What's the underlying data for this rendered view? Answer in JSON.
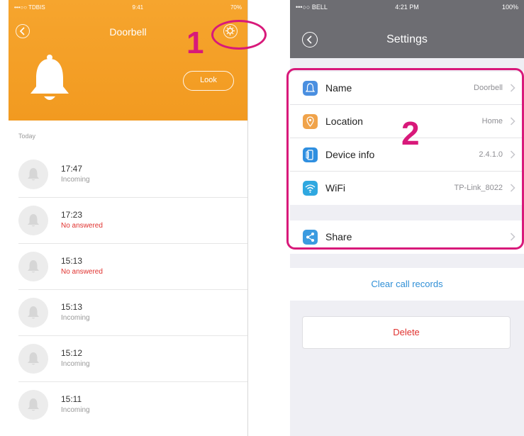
{
  "left": {
    "status": {
      "carrier": "•••○○ TDBIS",
      "time": "9:41",
      "battery": "70%"
    },
    "title": "Doorbell",
    "look_label": "Look",
    "section": "Today",
    "records": [
      {
        "time": "17:47",
        "status": "Incoming",
        "missed": false
      },
      {
        "time": "17:23",
        "status": "No answered",
        "missed": true
      },
      {
        "time": "15:13",
        "status": "No answered",
        "missed": true
      },
      {
        "time": "15:13",
        "status": "Incoming",
        "missed": false
      },
      {
        "time": "15:12",
        "status": "Incoming",
        "missed": false
      },
      {
        "time": "15:11",
        "status": "Incoming",
        "missed": false
      }
    ]
  },
  "right": {
    "status": {
      "carrier": "•••○○ BELL",
      "time": "4:21 PM",
      "battery": "100%"
    },
    "title": "Settings",
    "rows": [
      {
        "label": "Name",
        "value": "Doorbell",
        "icon": "bell-icon",
        "color": "#4a8fe0"
      },
      {
        "label": "Location",
        "value": "Home",
        "icon": "location-pin-icon",
        "color": "#f0a34a"
      },
      {
        "label": "Device info",
        "value": "2.4.1.0",
        "icon": "device-info-icon",
        "color": "#2f8fe0"
      },
      {
        "label": "WiFi",
        "value": "TP-Link_8022",
        "icon": "wifi-icon",
        "color": "#2fa8e0"
      }
    ],
    "share": {
      "label": "Share",
      "icon": "share-icon",
      "color": "#3b9be0"
    },
    "clear_label": "Clear call records",
    "delete_label": "Delete"
  },
  "annotations": {
    "step1": "1",
    "step2": "2"
  },
  "colors": {
    "accent": "#f29a20",
    "header_gray": "#6d6d72",
    "link_blue": "#2f8fd6",
    "alert_red": "#e0312e",
    "annotation_pink": "#d8197a"
  }
}
